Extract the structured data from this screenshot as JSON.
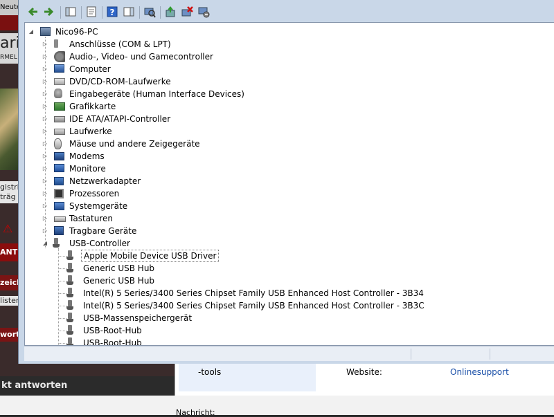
{
  "background_page": {
    "top_text": "Neute,",
    "brand": "ari",
    "brand_sub": "RMEL",
    "side_text_1": "gistri\nträg",
    "button_1": "ANT",
    "button_2": "zeich",
    "side_text_2": "lister",
    "button_3": "wort",
    "bottom_bar": "kt antworten",
    "panel_tools": "-tools",
    "panel_website": "Website:",
    "panel_support": "Onlinesupport",
    "nachricht": "Nachricht:"
  },
  "toolbar": {
    "buttons": [
      {
        "name": "back-icon"
      },
      {
        "name": "forward-icon"
      },
      {
        "name": "show-hide-console-tree-icon"
      },
      {
        "name": "properties-icon"
      },
      {
        "name": "help-icon"
      },
      {
        "name": "show-hide-action-pane-icon"
      },
      {
        "name": "scan-hardware-changes-icon"
      },
      {
        "name": "update-driver-icon"
      },
      {
        "name": "uninstall-icon"
      },
      {
        "name": "disable-device-icon"
      }
    ]
  },
  "tree": {
    "root": "Nico96-PC",
    "categories": [
      {
        "label": "Anschlüsse (COM & LPT)",
        "icon": "port-icon"
      },
      {
        "label": "Audio-, Video- und Gamecontroller",
        "icon": "audio-icon"
      },
      {
        "label": "Computer",
        "icon": "computer-icon"
      },
      {
        "label": "DVD/CD-ROM-Laufwerke",
        "icon": "dvd-drive-icon"
      },
      {
        "label": "Eingabegeräte (Human Interface Devices)",
        "icon": "hid-icon"
      },
      {
        "label": "Grafikkarte",
        "icon": "graphics-card-icon"
      },
      {
        "label": "IDE ATA/ATAPI-Controller",
        "icon": "ide-controller-icon"
      },
      {
        "label": "Laufwerke",
        "icon": "disk-drive-icon"
      },
      {
        "label": "Mäuse und andere Zeigegeräte",
        "icon": "mouse-icon"
      },
      {
        "label": "Modems",
        "icon": "modem-icon"
      },
      {
        "label": "Monitore",
        "icon": "monitor-icon"
      },
      {
        "label": "Netzwerkadapter",
        "icon": "network-adapter-icon"
      },
      {
        "label": "Prozessoren",
        "icon": "processor-icon"
      },
      {
        "label": "Systemgeräte",
        "icon": "system-devices-icon"
      },
      {
        "label": "Tastaturen",
        "icon": "keyboard-icon"
      },
      {
        "label": "Tragbare Geräte",
        "icon": "portable-devices-icon"
      }
    ],
    "usb_controller": {
      "label": "USB-Controller",
      "children": [
        {
          "label": "Apple Mobile Device USB Driver",
          "selected": true
        },
        {
          "label": "Generic USB Hub"
        },
        {
          "label": "Generic USB Hub"
        },
        {
          "label": "Intel(R) 5 Series/3400 Series Chipset Family USB Enhanced Host Controller - 3B34"
        },
        {
          "label": "Intel(R) 5 Series/3400 Series Chipset Family USB Enhanced Host Controller - 3B3C"
        },
        {
          "label": "USB-Massenspeichergerät"
        },
        {
          "label": "USB-Root-Hub"
        },
        {
          "label": "USB-Root-Hub"
        }
      ]
    }
  },
  "colors": {
    "window_frame": "#c9d7e8",
    "tree_background": "#ffffff",
    "background_dark_red": "#7a1414"
  }
}
